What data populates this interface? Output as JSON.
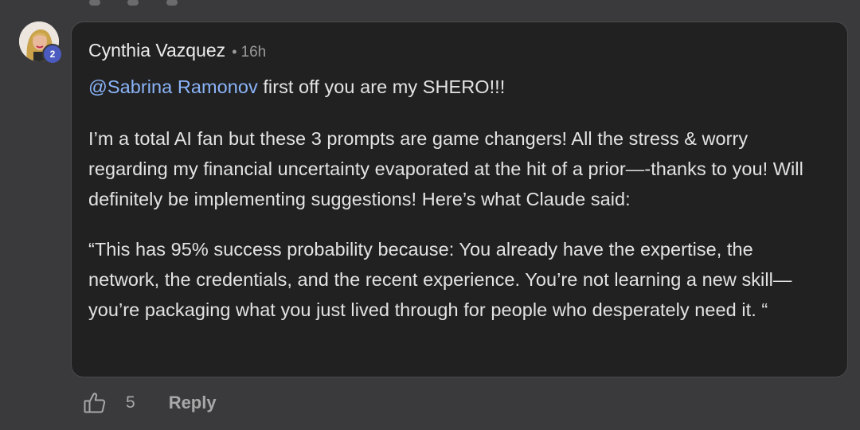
{
  "comment": {
    "author": "Cynthia Vazquez",
    "separator": "•",
    "time": "16h",
    "badge_count": "2",
    "mention": "@Sabrina Ramonov",
    "line1_rest": " first off you are my SHERO!!!",
    "paragraph2": "I’m a total AI fan but these 3 prompts are game changers! All the stress & worry regarding my financial uncertainty evaporated at the hit of a prior—-thanks to you! Will definitely be implementing suggestions! Here’s what Claude said:",
    "paragraph3": "“This has 95% success probability because: You already have the expertise, the network, the credentials, and the recent experience. You’re not learning a new skill—you’re packaging what you just lived through for people who desperately need it. “"
  },
  "actions": {
    "like_icon": "thumbs-up-icon",
    "like_count": "5",
    "reply_label": "Reply"
  },
  "colors": {
    "background": "#3a3a3c",
    "bubble": "#212121",
    "mention": "#8ab4f8",
    "badge": "#4b5bbf"
  }
}
